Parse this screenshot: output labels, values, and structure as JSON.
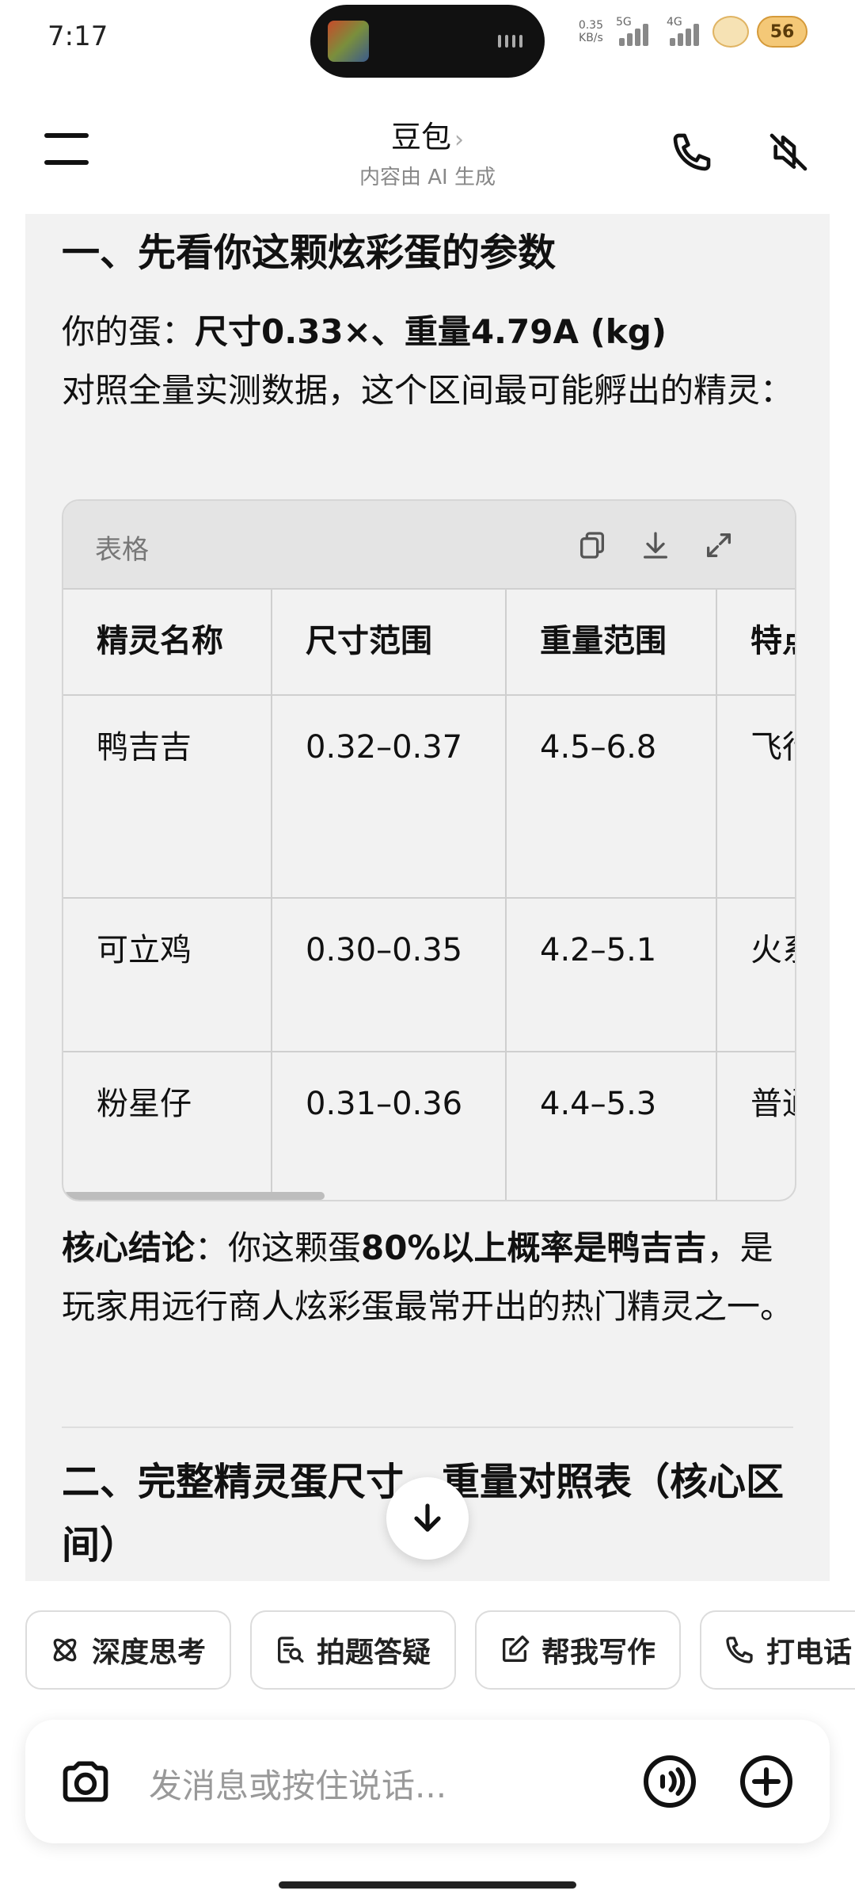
{
  "status": {
    "time": "7:17",
    "net_speed_value": "0.35",
    "net_speed_unit": "KB/s",
    "sig1_label": "5G",
    "sig2_label": "4G",
    "battery": "56"
  },
  "header": {
    "title": "豆包",
    "subtitle": "内容由 AI 生成"
  },
  "section1": {
    "heading": "一、先看你这颗炫彩蛋的参数",
    "egg_prefix": "你的蛋：",
    "egg_values": "尺寸0.33×、重量4.79A (kg)",
    "intro": "对照全量实测数据，这个区间最可能孵出的精灵："
  },
  "table": {
    "label": "表格",
    "headers": [
      "精灵名称",
      "尺寸范围",
      "重量范围",
      "特点"
    ],
    "rows": [
      [
        "鸭吉吉",
        "0.32–0.37",
        "4.5–6.8",
        "飞行远行出没"
      ],
      [
        "可立鸡",
        "0.30–0.35",
        "4.2–5.1",
        "火系尺寸重"
      ],
      [
        "粉星仔",
        "0.31–0.36",
        "4.4–5.3",
        "普通间相"
      ]
    ]
  },
  "conclusion": {
    "lead": "核心结论",
    "text1": "：你这颗蛋",
    "bold": "80%以上概率是鸭吉吉",
    "text2": "，是玩家用远行商人炫彩蛋最常开出的热门精灵之一。"
  },
  "section2": {
    "heading": "二、完整精灵蛋尺寸、重量对照表（核心区间）"
  },
  "chips": [
    {
      "label": "深度思考",
      "icon": "atom-icon"
    },
    {
      "label": "拍题答疑",
      "icon": "photo-search-icon"
    },
    {
      "label": "帮我写作",
      "icon": "edit-icon"
    },
    {
      "label": "打电话",
      "icon": "phone-icon"
    }
  ],
  "input": {
    "placeholder": "发消息或按住说话..."
  }
}
